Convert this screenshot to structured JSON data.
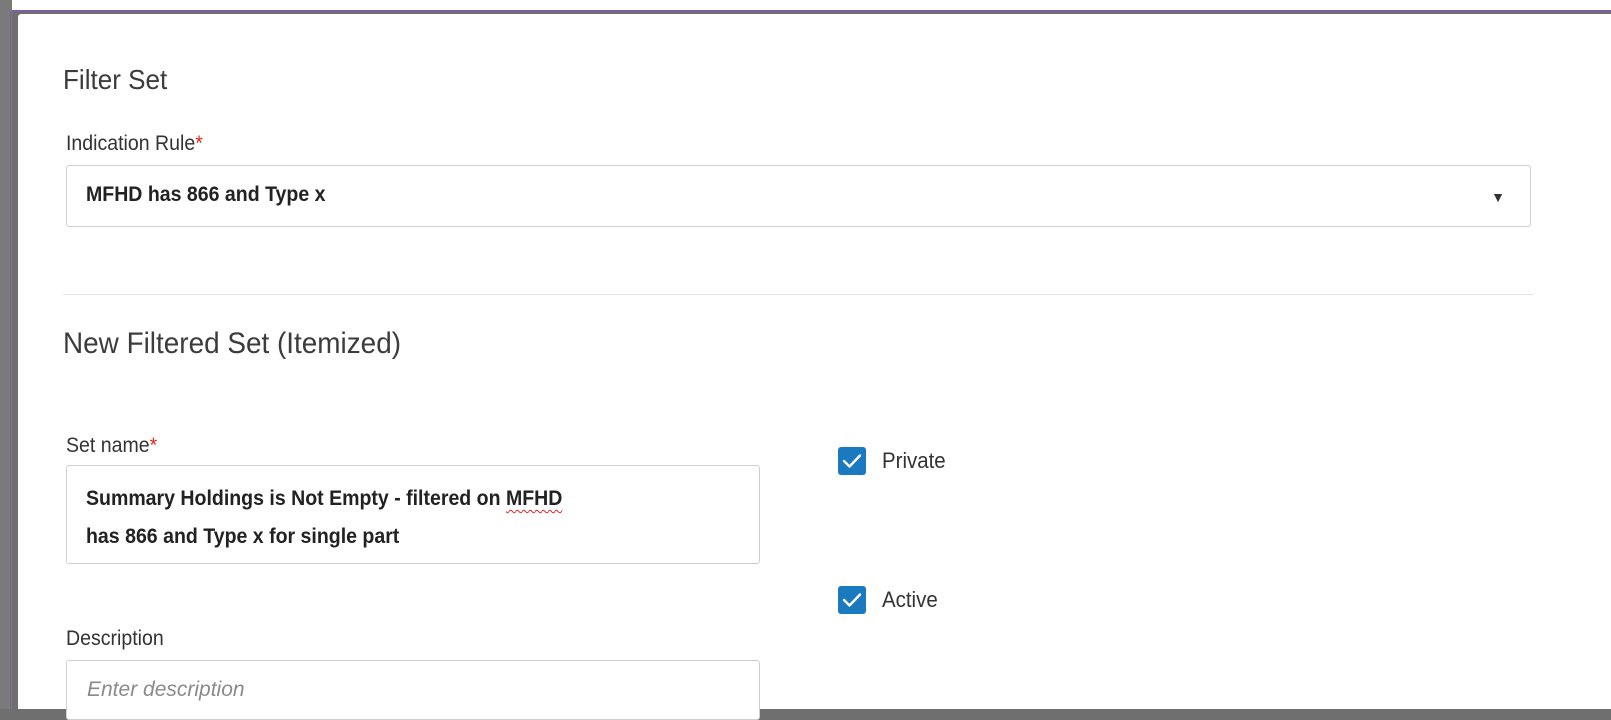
{
  "dialog": {
    "filter_section": {
      "title": "Filter Set",
      "indication_rule": {
        "label": "Indication Rule",
        "required_marker": "*",
        "value": "MFHD has 866 and Type x",
        "arrow": "▼"
      }
    },
    "new_set_section": {
      "title": "New Filtered Set (Itemized)",
      "set_name": {
        "label": "Set name",
        "required_marker": "*",
        "value_line1_prefix": "Summary Holdings is Not Empty - filtered on ",
        "value_line1_misspelled": "MFHD",
        "value_line2": "has 866 and Type x for single part"
      },
      "description": {
        "label": "Description",
        "placeholder": "Enter description",
        "value": ""
      },
      "private_checkbox": {
        "label": "Private",
        "checked": true
      },
      "active_checkbox": {
        "label": "Active",
        "checked": true
      }
    }
  },
  "colors": {
    "accent": "#1b79c0",
    "required": "#e1251b",
    "overlay": "#6f6f6f",
    "frame_border": "#7b5ea7"
  },
  "icons": {
    "dropdown": "chevron-down-icon",
    "checkbox": "checkmark-icon"
  }
}
